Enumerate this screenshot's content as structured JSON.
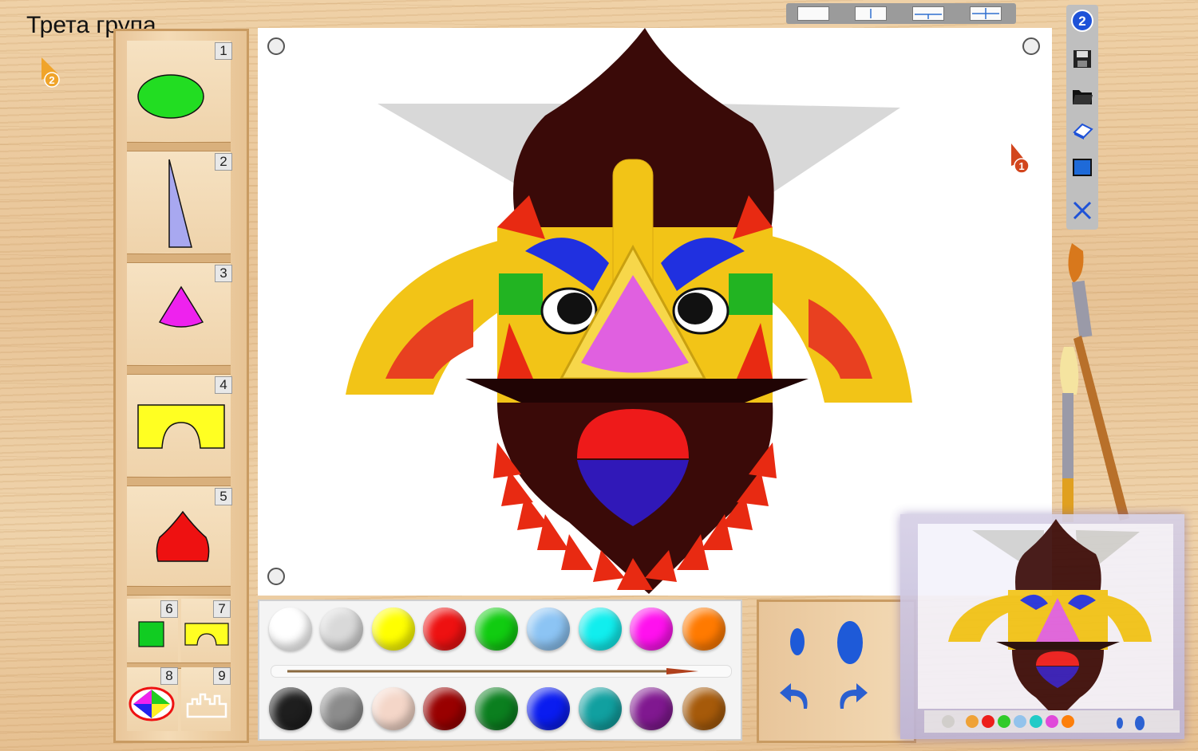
{
  "header": {
    "group_title": "Трета група"
  },
  "markers": {
    "left_step": "2",
    "canvas_step": "1"
  },
  "shape_palette": {
    "slots": [
      {
        "number": "1",
        "shape": "green-ellipse",
        "color": "#22dd22"
      },
      {
        "number": "2",
        "shape": "lavender-triangle",
        "color": "#a8a8f0"
      },
      {
        "number": "3",
        "shape": "magenta-sector",
        "color": "#ee22ee"
      },
      {
        "number": "4",
        "shape": "yellow-arch",
        "color": "#ffff22"
      },
      {
        "number": "5",
        "shape": "red-dome",
        "color": "#ee1111"
      }
    ],
    "small_slots": [
      {
        "number": "6",
        "shape": "green-square",
        "color": "#11cc22"
      },
      {
        "number": "7",
        "shape": "yellow-arch-small",
        "color": "#ffff22"
      },
      {
        "number": "8",
        "shape": "multicolor-ellipse",
        "color": "#ee1111"
      },
      {
        "number": "9",
        "shape": "castle-outline",
        "color": "#ffffff"
      }
    ]
  },
  "toolbar": {
    "step_badge": "2",
    "tools": [
      "save-icon",
      "open-folder-icon",
      "eraser-icon",
      "fill-icon",
      "close-icon"
    ]
  },
  "symmetry_modes": [
    "none",
    "vertical",
    "horizontal-cross",
    "cross"
  ],
  "colors": {
    "row1": [
      "#ffffff",
      "#d9d9d9",
      "#ffff00",
      "#ee1111",
      "#11cc11",
      "#8cc4f4",
      "#11eeee",
      "#ff11ee",
      "#ff7a00"
    ],
    "row2": [
      "#1e1e1e",
      "#8c8c8c",
      "#f4d6c8",
      "#990000",
      "#0b7f1f",
      "#0a1cf0",
      "#11a0a0",
      "#801890",
      "#a65a0a"
    ]
  },
  "brush_tools": [
    "small-brush-icon",
    "large-brush-icon",
    "undo-icon",
    "redo-icon"
  ]
}
